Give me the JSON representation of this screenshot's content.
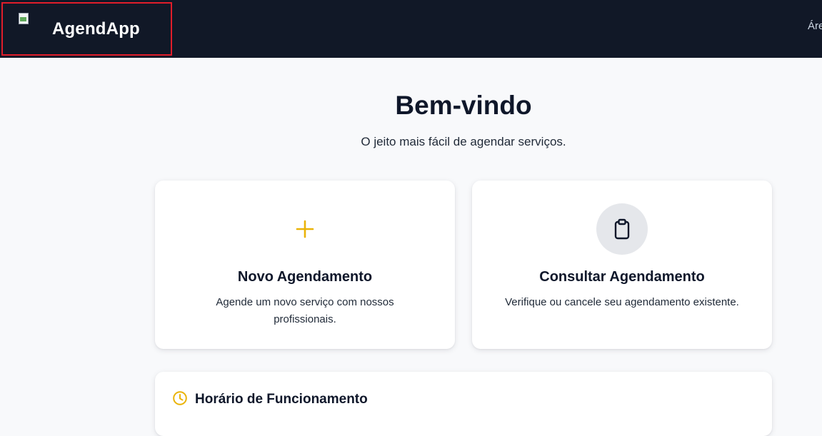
{
  "header": {
    "brand_name": "AgendApp",
    "nav_link": "Áre"
  },
  "hero": {
    "title": "Bem-vindo",
    "subtitle": "O jeito mais fácil de agendar serviços."
  },
  "cards": {
    "new": {
      "title": "Novo Agendamento",
      "description": "Agende um novo serviço com nossos profissionais.",
      "icon": "plus-icon"
    },
    "lookup": {
      "title": "Consultar Agendamento",
      "description": "Verifique ou cancele seu agendamento existente.",
      "icon": "clipboard-icon"
    }
  },
  "hours": {
    "title": "Horário de Funcionamento",
    "icon": "clock-icon"
  },
  "colors": {
    "navbar_bg": "#111827",
    "accent": "#eab308",
    "highlight_border": "#e11d2a",
    "page_bg": "#f8f9fb"
  }
}
